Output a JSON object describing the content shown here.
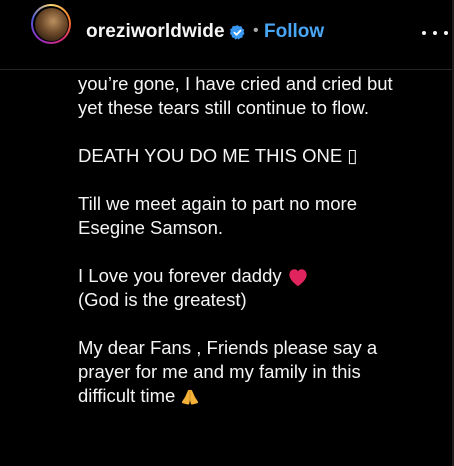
{
  "header": {
    "username": "oreziworldwide",
    "separator": "•",
    "follow_label": "Follow",
    "verified_icon": "verified-badge-icon",
    "more_icon": "more-horizontal-icon"
  },
  "caption": {
    "p1_line1": "you’re gone, I have cried and cried but",
    "p1_line2": "yet these tears still continue to flow.",
    "p2_line1": "DEATH YOU DO ME THIS ONE ▯",
    "p3_line1": "Till we meet again to part no more",
    "p3_line2": "Esegine Samson.",
    "p4_line1": "I Love you forever daddy",
    "p4_line2": "(God is the greatest)",
    "p5_line1": "My dear Fans , Friends please say a",
    "p5_line2": "prayer for me and my family in this",
    "p5_line3": "difficult time"
  },
  "colors": {
    "background": "#000000",
    "text": "#f5f5f5",
    "follow": "#4aa6f5",
    "verified": "#3897f0",
    "heart": "#e0245e",
    "hands": "#f4b23a"
  }
}
